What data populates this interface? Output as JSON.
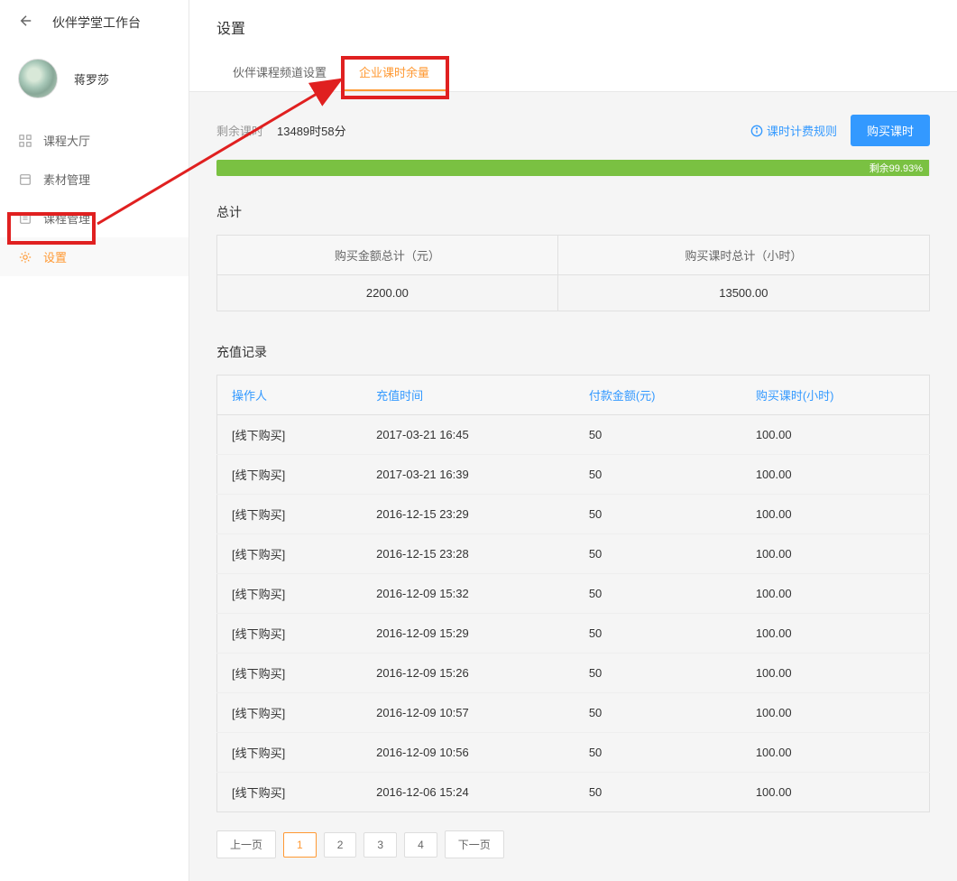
{
  "sidebar": {
    "workspace_title": "伙伴学堂工作台",
    "username": "蒋罗莎",
    "nav": [
      {
        "label": "课程大厅",
        "icon": "grid-icon"
      },
      {
        "label": "素材管理",
        "icon": "folder-icon"
      },
      {
        "label": "课程管理",
        "icon": "list-icon"
      },
      {
        "label": "设置",
        "icon": "gear-icon"
      }
    ]
  },
  "page": {
    "title": "设置",
    "tabs": [
      {
        "label": "伙伴课程频道设置"
      },
      {
        "label": "企业课时余量"
      }
    ]
  },
  "remaining": {
    "label": "剩余课时",
    "value": "13489时58分",
    "billing_rules": "课时计费规则",
    "buy_button": "购买课时"
  },
  "progress": {
    "text": "剩余99.93%",
    "percent": 99.93
  },
  "totals": {
    "section_title": "总计",
    "headers": [
      "购买金额总计（元）",
      "购买课时总计（小时）"
    ],
    "values": [
      "2200.00",
      "13500.00"
    ]
  },
  "records": {
    "section_title": "充值记录",
    "headers": [
      "操作人",
      "充值时间",
      "付款金额(元)",
      "购买课时(小时)"
    ],
    "rows": [
      {
        "operator": "[线下购买]",
        "time": "2017-03-21 16:45",
        "amount": "50",
        "hours": "100.00"
      },
      {
        "operator": "[线下购买]",
        "time": "2017-03-21 16:39",
        "amount": "50",
        "hours": "100.00"
      },
      {
        "operator": "[线下购买]",
        "time": "2016-12-15 23:29",
        "amount": "50",
        "hours": "100.00"
      },
      {
        "operator": "[线下购买]",
        "time": "2016-12-15 23:28",
        "amount": "50",
        "hours": "100.00"
      },
      {
        "operator": "[线下购买]",
        "time": "2016-12-09 15:32",
        "amount": "50",
        "hours": "100.00"
      },
      {
        "operator": "[线下购买]",
        "time": "2016-12-09 15:29",
        "amount": "50",
        "hours": "100.00"
      },
      {
        "operator": "[线下购买]",
        "time": "2016-12-09 15:26",
        "amount": "50",
        "hours": "100.00"
      },
      {
        "operator": "[线下购买]",
        "time": "2016-12-09 10:57",
        "amount": "50",
        "hours": "100.00"
      },
      {
        "operator": "[线下购买]",
        "time": "2016-12-09 10:56",
        "amount": "50",
        "hours": "100.00"
      },
      {
        "operator": "[线下购买]",
        "time": "2016-12-06 15:24",
        "amount": "50",
        "hours": "100.00"
      }
    ]
  },
  "pagination": {
    "prev": "上一页",
    "next": "下一页",
    "pages": [
      "1",
      "2",
      "3",
      "4"
    ]
  }
}
